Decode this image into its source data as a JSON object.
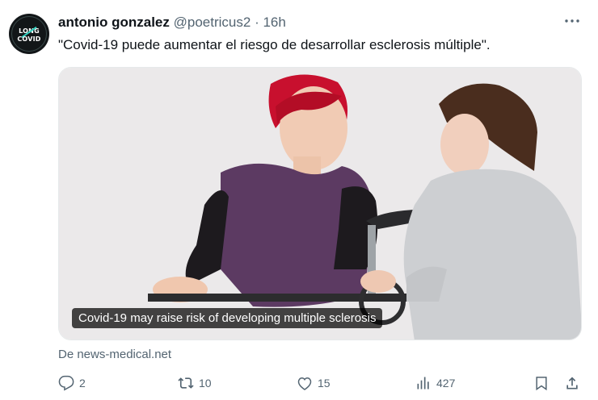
{
  "tweet": {
    "author_name": "antonio gonzalez",
    "handle": "@poetricus2",
    "separator": "·",
    "time": "16h",
    "text": "\"Covid-19 puede aumentar el riesgo de desarrollar esclerosis múltiple\".",
    "avatar_text_top": "LONG",
    "avatar_text_bottom": "COVID"
  },
  "card": {
    "caption": "Covid-19 may raise risk of developing multiple sclerosis",
    "source": "De news-medical.net"
  },
  "actions": {
    "reply_count": "2",
    "retweet_count": "10",
    "like_count": "15",
    "views_count": "427"
  },
  "icons": {
    "more": "more-icon",
    "reply": "reply-icon",
    "retweet": "retweet-icon",
    "like": "heart-icon",
    "views": "views-icon",
    "bookmark": "bookmark-icon",
    "share": "share-icon"
  },
  "colors": {
    "text": "#0f1419",
    "muted": "#536471"
  }
}
